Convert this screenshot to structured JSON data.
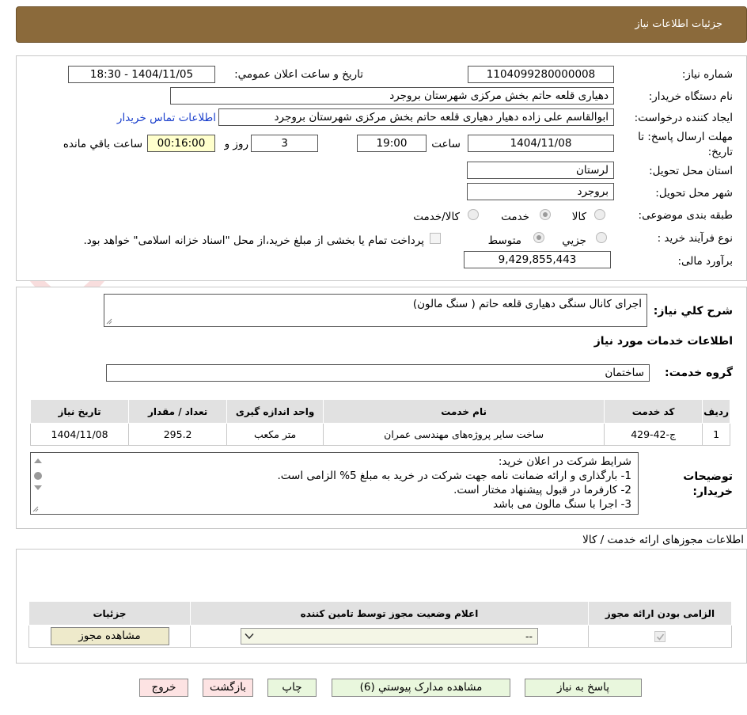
{
  "window": {
    "title": "جزئیات اطلاعات نیاز"
  },
  "fields": {
    "need_number_label": "شماره نیاز:",
    "need_number": "1104099280000008",
    "announce_label": "تاریخ و ساعت اعلان عمومي:",
    "announce_value": "1404/11/05 - 18:30",
    "buyer_org_label": "نام دستگاه خریدار:",
    "buyer_org": "دهیاری قلعه حاتم بخش مرکزی شهرستان بروجرد",
    "requester_label": "ایجاد کننده درخواست:",
    "requester": "ابوالقاسم علی زاده دهیار دهیاری قلعه حاتم بخش مرکزی شهرستان بروجرد",
    "contact_link": "اطلاعات تماس خریدار",
    "deadline_label_line1": "مهلت ارسال پاسخ: تا",
    "deadline_label_line2": "تاریخ:",
    "deadline_date": "1404/11/08",
    "time_label": "ساعت",
    "deadline_time": "19:00",
    "days": "3",
    "days_label": "روز و",
    "remaining": "00:16:00",
    "remaining_label": "ساعت باقي مانده",
    "province_label": "استان محل تحویل:",
    "province": "لرستان",
    "city_label": "شهر محل تحویل:",
    "city": "بروجرد",
    "category_label": "طبقه بندی موضوعی:",
    "category_options": [
      "کالا",
      "خدمت",
      "کالا/خدمت"
    ],
    "category_selected": "خدمت",
    "process_label": "نوع فرآیند خرید :",
    "process_options": [
      "جزیي",
      "متوسط"
    ],
    "process_selected": "متوسط",
    "process_note": "پرداخت تمام یا بخشی از مبلغ خرید،از محل \"اسناد خزانه اسلامی\" خواهد بود.",
    "budget_label": "برآورد مالی:",
    "budget": "9,429,855,443"
  },
  "summary": {
    "label": "شرح کلي نیاز:",
    "value": "اجرای کانال سنگی دهیاری قلعه حاتم ( سنگ مالون)"
  },
  "services": {
    "heading": "اطلاعات خدمات مورد نیاز",
    "group_label": "گروه خدمت:",
    "group_value": "ساختمان",
    "columns": [
      "ردیف",
      "کد خدمت",
      "نام خدمت",
      "واحد اندازه گیری",
      "تعداد / مقدار",
      "تاریخ نیاز"
    ],
    "rows": [
      [
        "1",
        "ج-42-429",
        "ساخت سایر پروژه‌های مهندسی عمران",
        "متر مکعب",
        "295.2",
        "1404/11/08"
      ]
    ]
  },
  "buyer_notes": {
    "label_line1": "توضیحات",
    "label_line2": "خریدار:",
    "lines": [
      "شرایط شرکت در اعلان خرید:",
      "1-     بارگذاری و ارائه ضمانت نامه جهت شرکت در خرید به مبلغ 5% الزامی است.",
      "2-     کارفرما در قبول پیشنهاد مختار است.",
      "3-     اجرا با سنگ مالون می باشد"
    ]
  },
  "permits": {
    "heading": "اطلاعات مجوزهای ارائه خدمت / کالا",
    "columns": [
      "الزامی بودن ارائه مجوز",
      "اعلام وضعیت مجوز توسط تامین کننده",
      "جزئیات"
    ],
    "select_value": "--",
    "view_button": "مشاهده مجوز"
  },
  "buttons": {
    "reply": "پاسخ به نیاز",
    "attachments": "مشاهده مدارک پیوستي (6)",
    "print": "چاپ",
    "back": "بازگشت",
    "exit": "خروج"
  },
  "watermark": {
    "text": "AriaTender.neT"
  },
  "colors": {
    "title_bar": "#8b6a3b",
    "link": "#1a3fcc",
    "highlight_box": "#ffffcc",
    "table_header": "#e1e1e1",
    "btn_green": "#e9f7dd",
    "btn_pink": "#fde3e3"
  }
}
